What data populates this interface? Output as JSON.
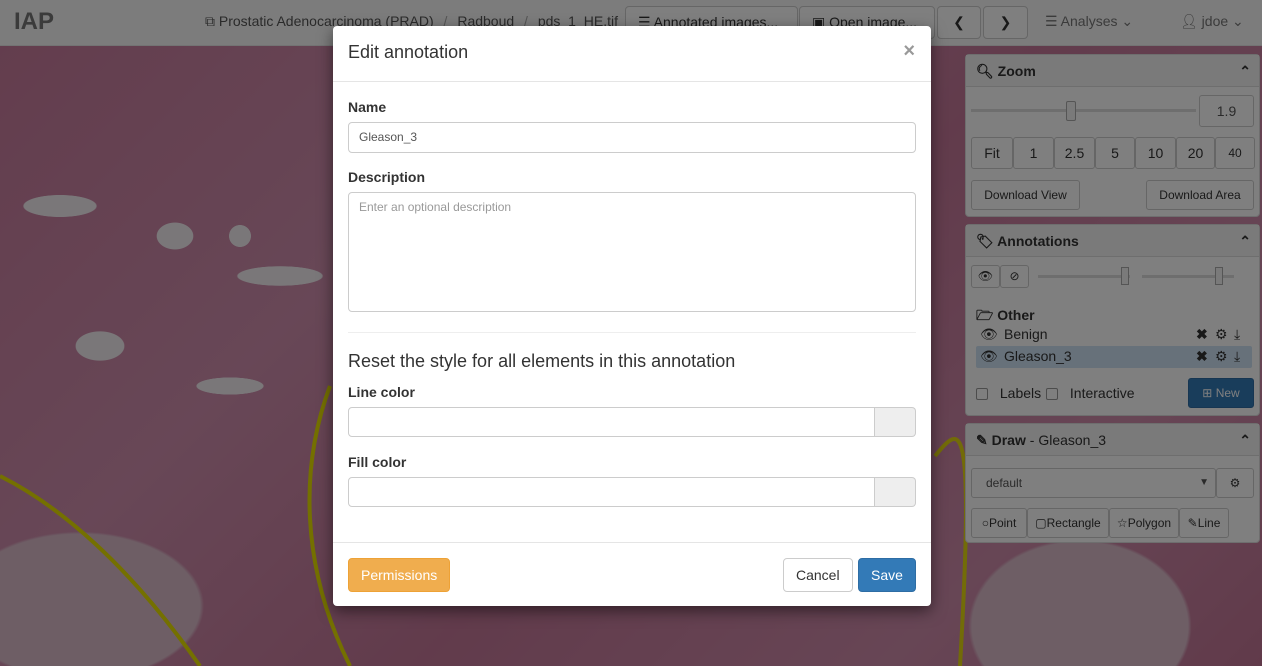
{
  "navbar": {
    "brand": "IAP",
    "breadcrumb": [
      "Prostatic Adenocarcinoma (PRAD)",
      "Radboud",
      "pds_1_HE.tif"
    ],
    "annotated_images_label": "Annotated images...",
    "open_image_label": "Open image...",
    "analyses_label": "Analyses",
    "user_label": "jdoe"
  },
  "zoom_panel": {
    "title": "Zoom",
    "value": "1.9",
    "presets": [
      "Fit",
      "1",
      "2.5",
      "5",
      "10",
      "20",
      "40"
    ],
    "download_view": "Download View",
    "download_area": "Download Area"
  },
  "annotations_panel": {
    "title": "Annotations",
    "folder": "Other",
    "items": [
      {
        "name": "Benign",
        "selected": false
      },
      {
        "name": "Gleason_3",
        "selected": true
      }
    ],
    "labels_label": "Labels",
    "interactive_label": "Interactive",
    "new_label": "New"
  },
  "draw_panel": {
    "title": "Draw",
    "subtitle": "Gleason_3",
    "style_value": "default",
    "tools": [
      "Point",
      "Rectangle",
      "Polygon",
      "Line"
    ]
  },
  "modal": {
    "title": "Edit annotation",
    "close_glyph": "×",
    "name_label": "Name",
    "name_value": "Gleason_3",
    "description_label": "Description",
    "description_placeholder": "Enter an optional description",
    "reset_heading": "Reset the style for all elements in this annotation",
    "line_color_label": "Line color",
    "fill_color_label": "Fill color",
    "permissions_label": "Permissions",
    "cancel_label": "Cancel",
    "save_label": "Save"
  },
  "colors": {
    "primary": "#337ab7",
    "warning": "#f0ad4e",
    "annotation_line": "#e8e000",
    "selected_row": "#cfe3f5"
  }
}
